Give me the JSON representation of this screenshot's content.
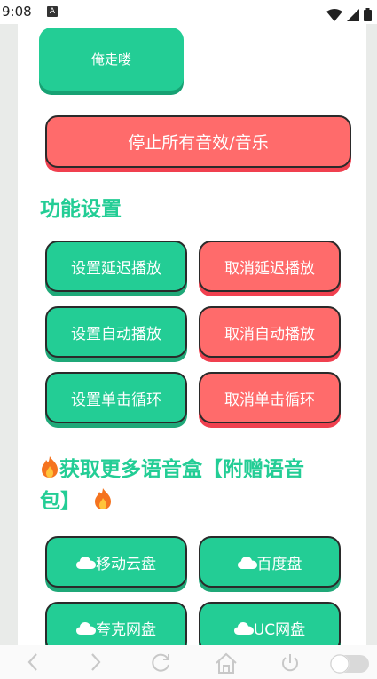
{
  "status_bar": {
    "time": "9:08",
    "a_badge": "A"
  },
  "top_button": {
    "label": "俺走喽"
  },
  "stop_button": {
    "label": "停止所有音效/音乐"
  },
  "function_settings": {
    "title": "功能设置",
    "buttons": [
      {
        "label": "设置延迟播放"
      },
      {
        "label": "取消延迟播放"
      },
      {
        "label": "设置自动播放"
      },
      {
        "label": "取消自动播放"
      },
      {
        "label": "设置单击循环"
      },
      {
        "label": "取消单击循环"
      }
    ]
  },
  "more_voice": {
    "title_line1": "获取更多语音盒【附赠语音",
    "title_line2": "包】",
    "icon": "fire-icon",
    "buttons": [
      {
        "label": "移动云盘",
        "icon": "cloud-icon"
      },
      {
        "label": "百度盘",
        "icon": "cloud-icon"
      },
      {
        "label": "夸克网盘",
        "icon": "cloud-icon"
      },
      {
        "label": "UC网盘",
        "icon": "cloud-icon"
      }
    ]
  },
  "colors": {
    "green": "#23cd95",
    "red": "#ff6b6b",
    "background": "#e9ebe9"
  },
  "bottom_nav": [
    "back-icon",
    "forward-icon",
    "refresh-icon",
    "home-icon",
    "power-icon",
    "toggle-icon"
  ]
}
